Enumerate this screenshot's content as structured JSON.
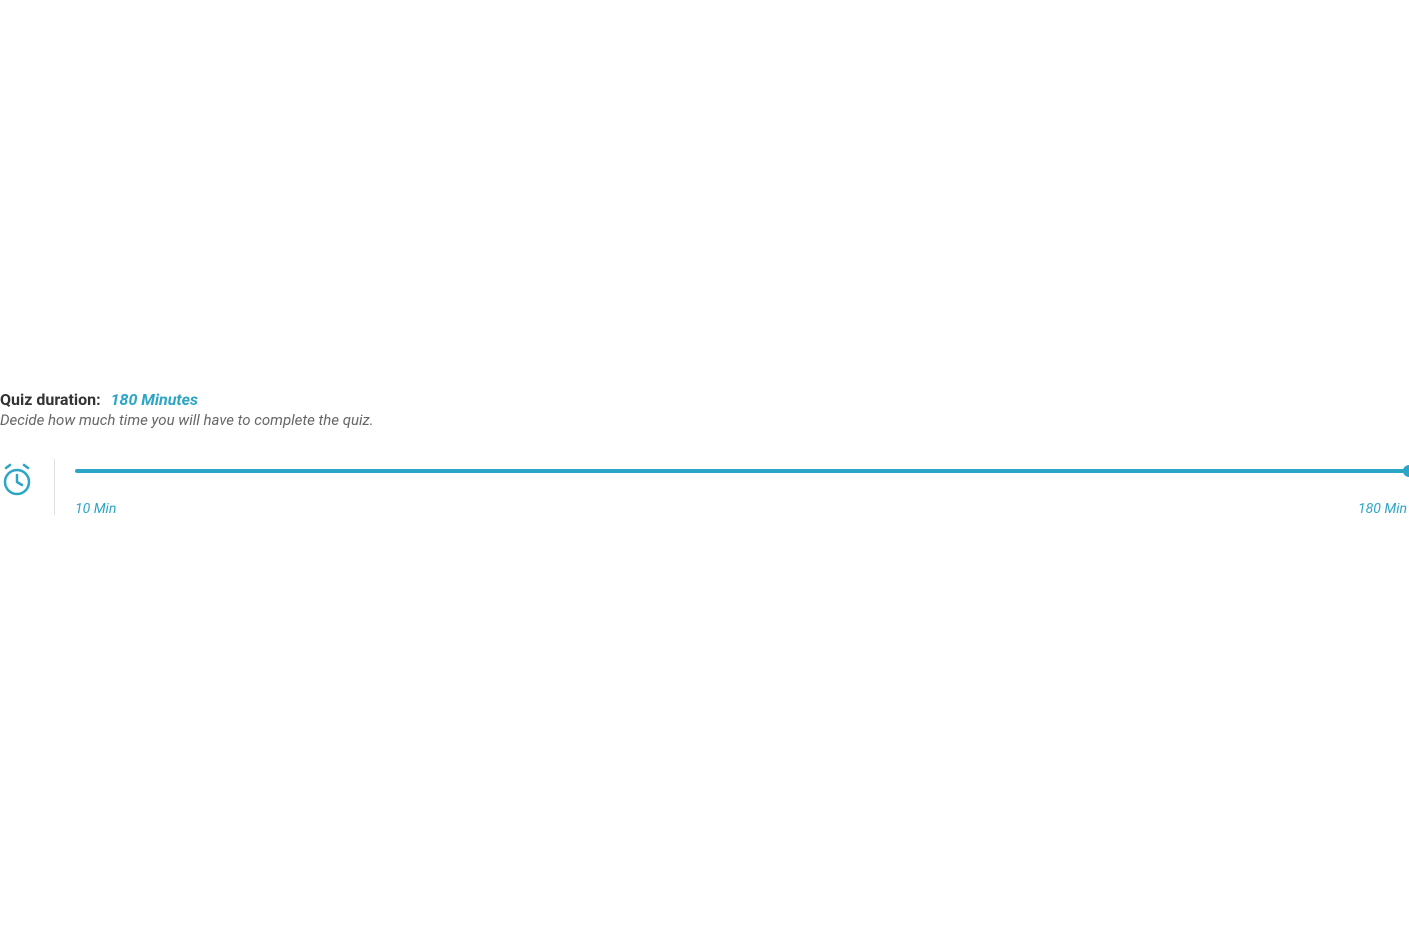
{
  "duration": {
    "label": "Quiz duration:",
    "value": "180 Minutes",
    "description": "Decide how much time you will have to complete the quiz.",
    "min_label": "10 Min",
    "max_label": "180 Min",
    "accent_color": "#2ba6c6"
  }
}
